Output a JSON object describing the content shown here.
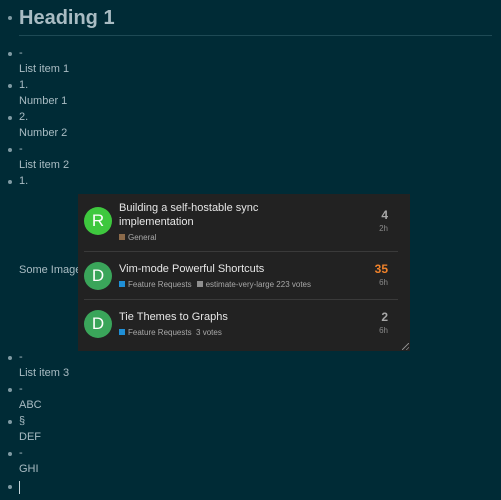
{
  "heading": "Heading 1",
  "items": [
    {
      "marker": "-",
      "text": "List item 1"
    },
    {
      "marker": "1.",
      "text": "Number 1"
    },
    {
      "marker": "2.",
      "text": "Number 2"
    },
    {
      "marker": "-",
      "text": "List item 2"
    },
    {
      "marker": "1.",
      "text": ""
    }
  ],
  "image_label": "Some Image",
  "embed": {
    "topics": [
      {
        "avatar_letter": "R",
        "avatar_color": "#3ec83e",
        "title": "Building a self-hostable sync implementation",
        "category": "General",
        "category_color": "#8b6a4a",
        "tag": "",
        "votes": "",
        "count": "4",
        "count_color": "#a8a8a8",
        "age": "2h"
      },
      {
        "avatar_letter": "D",
        "avatar_color": "#3aa55a",
        "title": "Vim-mode Powerful Shortcuts",
        "category": "Feature Requests",
        "category_color": "#1f8fd6",
        "tag": "estimate-very-large",
        "votes": "223 votes",
        "count": "35",
        "count_color": "#f0822a",
        "age": "6h"
      },
      {
        "avatar_letter": "D",
        "avatar_color": "#3aa55a",
        "title": "Tie Themes to Graphs",
        "category": "Feature Requests",
        "category_color": "#1f8fd6",
        "tag": "",
        "votes": "3 votes",
        "count": "2",
        "count_color": "#a8a8a8",
        "age": "6h"
      }
    ]
  },
  "items_after": [
    {
      "marker": "-",
      "text": "List item 3"
    },
    {
      "marker": "-",
      "text": "ABC"
    },
    {
      "marker": "§",
      "text": "DEF"
    },
    {
      "marker": "-",
      "text": "GHI"
    }
  ]
}
